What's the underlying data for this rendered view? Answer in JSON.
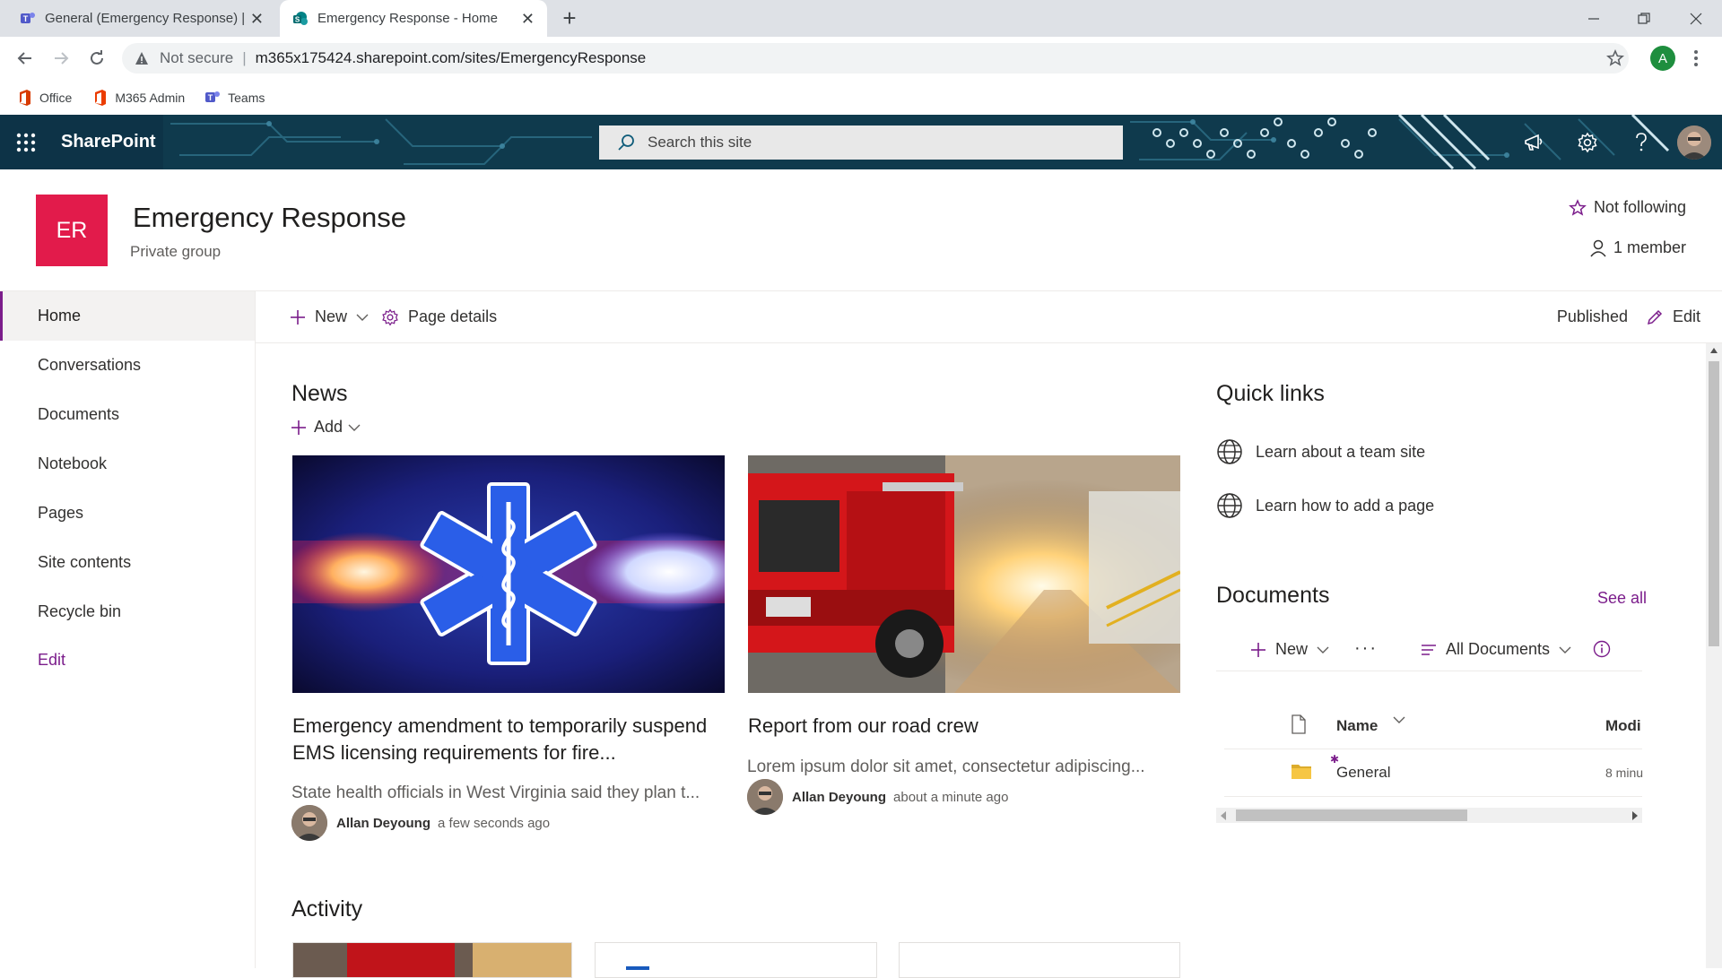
{
  "browser": {
    "tabs": [
      {
        "title": "General (Emergency Response) | M",
        "active": false,
        "icon": "teams-icon"
      },
      {
        "title": "Emergency Response - Home",
        "active": true,
        "icon": "sharepoint-icon"
      }
    ],
    "address": {
      "security_label": "Not secure",
      "url": "m365x175424.sharepoint.com/sites/EmergencyResponse"
    },
    "profile_initial": "A",
    "bookmarks": [
      {
        "label": "Office",
        "icon": "office-icon"
      },
      {
        "label": "M365 Admin",
        "icon": "office-icon"
      },
      {
        "label": "Teams",
        "icon": "teams-icon"
      }
    ]
  },
  "suitebar": {
    "brand": "SharePoint",
    "search_placeholder": "Search this site"
  },
  "site": {
    "logo_initials": "ER",
    "title": "Emergency Response",
    "subtitle": "Private group",
    "follow_label": "Not following",
    "members_label": "1 member"
  },
  "nav": {
    "items": [
      {
        "label": "Home",
        "selected": true
      },
      {
        "label": "Conversations"
      },
      {
        "label": "Documents"
      },
      {
        "label": "Notebook"
      },
      {
        "label": "Pages"
      },
      {
        "label": "Site contents"
      },
      {
        "label": "Recycle bin"
      },
      {
        "label": "Edit"
      }
    ]
  },
  "commandbar": {
    "new_label": "New",
    "page_details_label": "Page details",
    "status_label": "Published",
    "edit_label": "Edit"
  },
  "news": {
    "title": "News",
    "add_label": "Add",
    "items": [
      {
        "title": "Emergency amendment to temporarily suspend EMS licensing requirements for fire...",
        "description": "State health officials in West Virginia said they plan t...",
        "author": "Allan Deyoung",
        "time": "a few seconds ago"
      },
      {
        "title": "Report from our road crew",
        "description": "Lorem ipsum dolor sit amet, consectetur adipiscing...",
        "author": "Allan Deyoung",
        "time": "about a minute ago"
      }
    ]
  },
  "quicklinks": {
    "title": "Quick links",
    "items": [
      {
        "label": "Learn about a team site",
        "icon": "globe-icon"
      },
      {
        "label": "Learn how to add a page",
        "icon": "globe-icon"
      }
    ]
  },
  "documents": {
    "title": "Documents",
    "see_all": "See all",
    "new_label": "New",
    "view_label": "All Documents",
    "col_name": "Name",
    "col_modified": "Modi",
    "rows": [
      {
        "name": "General",
        "modified": "8 minu",
        "type": "folder"
      }
    ]
  },
  "activity": {
    "title": "Activity"
  },
  "colors": {
    "suitebar": "#0f3a4d",
    "site_logo": "#e21b4b",
    "accent": "#7b1d8b"
  }
}
